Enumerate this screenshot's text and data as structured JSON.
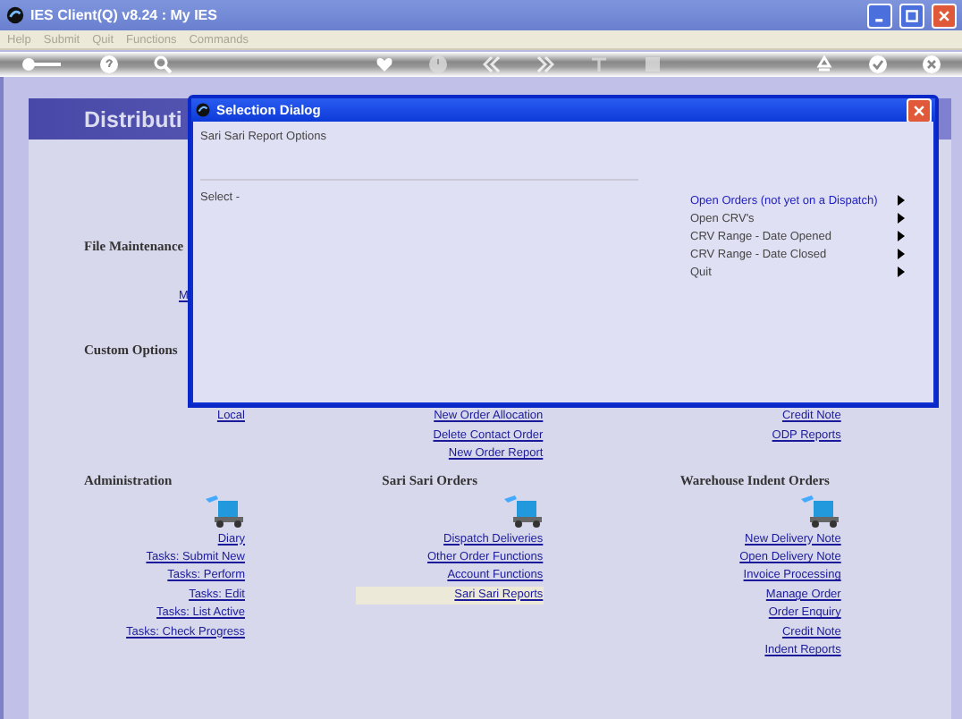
{
  "window": {
    "title": "IES Client(Q) v8.24 : My IES"
  },
  "menu": [
    {
      "label": "Help",
      "disabled": true
    },
    {
      "label": "Submit",
      "disabled": true
    },
    {
      "label": "Quit",
      "disabled": true
    },
    {
      "label": "Functions",
      "disabled": true
    },
    {
      "label": "Commands",
      "disabled": true
    }
  ],
  "page": {
    "title": "Distributi",
    "file_maintenance": {
      "title": "File Maintenance",
      "links": [
        "M"
      ]
    },
    "custom_options": {
      "title": "Custom Options"
    },
    "upper_columns": [
      {
        "links": [
          "Local"
        ]
      },
      {
        "links": [
          "New Order Allocation",
          "Delete Contact Order",
          "New Order Report"
        ]
      },
      {
        "links": [
          "Credit Note",
          "ODP Reports"
        ]
      }
    ],
    "groups": [
      {
        "title": "Administration",
        "links": [
          {
            "label": "Diary",
            "selected": false
          },
          {
            "label": "Tasks: Submit New",
            "selected": false
          },
          {
            "label": "Tasks: Perform",
            "selected": false
          },
          {
            "label": "Tasks: Edit",
            "selected": false
          },
          {
            "label": "Tasks: List Active",
            "selected": false
          },
          {
            "label": "Tasks: Check Progress",
            "selected": false
          }
        ]
      },
      {
        "title": "Sari Sari Orders",
        "links": [
          {
            "label": "Dispatch Deliveries",
            "selected": false
          },
          {
            "label": "Other Order Functions",
            "selected": false
          },
          {
            "label": "Account Functions",
            "selected": false
          },
          {
            "label": "Sari Sari Reports",
            "selected": true
          }
        ]
      },
      {
        "title": "Warehouse Indent Orders",
        "links": [
          {
            "label": "New Delivery Note",
            "selected": false
          },
          {
            "label": "Open Delivery Note",
            "selected": false
          },
          {
            "label": "Invoice Processing",
            "selected": false
          },
          {
            "label": "Manage Order",
            "selected": false
          },
          {
            "label": "Order Enquiry",
            "selected": false
          },
          {
            "label": "Credit Note",
            "selected": false
          },
          {
            "label": "Indent Reports",
            "selected": false
          }
        ]
      }
    ]
  },
  "dialog": {
    "title": "Selection Dialog",
    "subtitle": "Sari Sari Report Options",
    "prompt": "Select -",
    "options": [
      {
        "label": "Open Orders (not yet on a Dispatch)",
        "selected": true
      },
      {
        "label": "Open CRV's",
        "selected": false
      },
      {
        "label": "CRV Range - Date Opened",
        "selected": false
      },
      {
        "label": "CRV Range - Date Closed",
        "selected": false
      },
      {
        "label": "Quit",
        "selected": false
      }
    ]
  }
}
